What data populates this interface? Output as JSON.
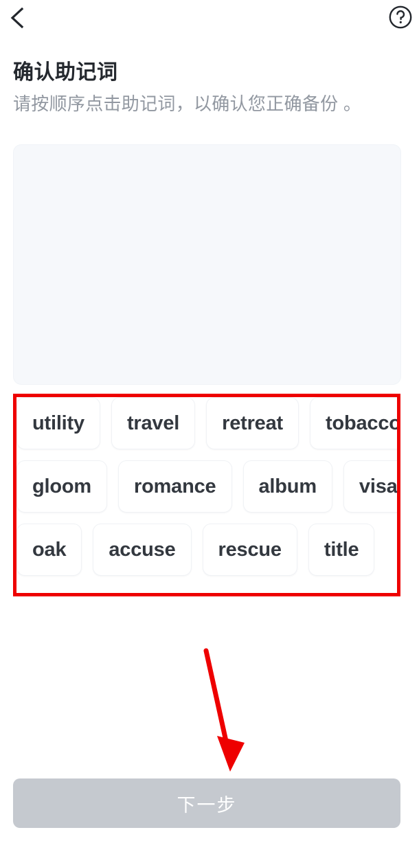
{
  "topbar": {
    "back_icon": "chevron-left-icon",
    "help_icon": "help-circle-icon"
  },
  "header": {
    "title": "确认助记词",
    "subtitle": "请按顺序点击助记词，以确认您正确备份 。"
  },
  "selection_panel": {
    "selected_words": [],
    "background_color": "#f6f8fb"
  },
  "word_bank": {
    "highlight_color": "#ee0000",
    "rows": [
      [
        "utility",
        "travel",
        "retreat",
        "tobacco"
      ],
      [
        "gloom",
        "romance",
        "album",
        "visa"
      ],
      [
        "oak",
        "accuse",
        "rescue",
        "title"
      ]
    ],
    "words": [
      "utility",
      "travel",
      "retreat",
      "tobacco",
      "gloom",
      "romance",
      "album",
      "visa",
      "oak",
      "accuse",
      "rescue",
      "title"
    ]
  },
  "annotation": {
    "arrow_color": "#ee0000"
  },
  "footer": {
    "next_label": "下一步",
    "next_enabled": false,
    "next_color": "#c5c9cf"
  }
}
